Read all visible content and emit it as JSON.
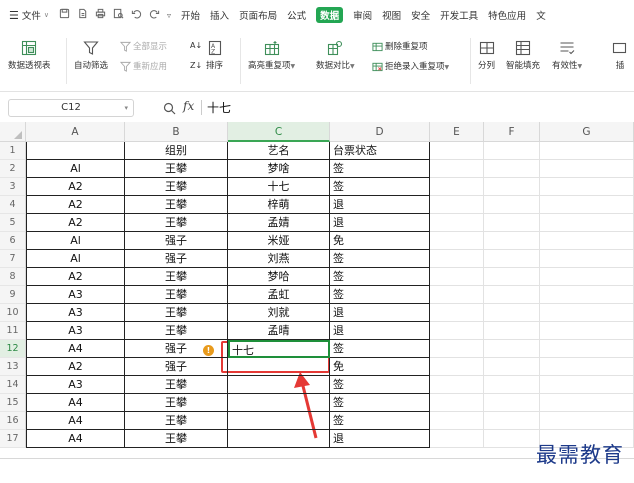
{
  "menu": {
    "file_label": "文件",
    "tabs": [
      "开始",
      "插入",
      "页面布局",
      "公式",
      "数据",
      "审阅",
      "视图",
      "安全",
      "开发工具",
      "特色应用",
      "文"
    ],
    "active_tab": "数据"
  },
  "ribbon": {
    "pivot": "数据透视表",
    "autofilter": "自动筛选",
    "show_all": "全部显示",
    "reapply": "重新应用",
    "sort": "排序",
    "highlight_dup": "高亮重复项",
    "compare": "数据对比",
    "remove_dup": "删除重复项",
    "reject_dup": "拒绝录入重复项",
    "split": "分列",
    "smart_fill": "智能填充",
    "validity": "有效性",
    "more": "插"
  },
  "formula_bar": {
    "cell_ref": "C12",
    "fx": "fx",
    "value": "十七"
  },
  "columns": [
    "A",
    "B",
    "C",
    "D",
    "E",
    "F",
    "G"
  ],
  "selected_column": "C",
  "selected_row": 12,
  "rows": [
    {
      "n": "1",
      "a": "",
      "b": "组别",
      "c": "艺名",
      "d": "台票状态"
    },
    {
      "n": "2",
      "a": "Al",
      "b": "王攀",
      "c": "梦啥",
      "d": "签"
    },
    {
      "n": "3",
      "a": "A2",
      "b": "王攀",
      "c": "十七",
      "d": "签"
    },
    {
      "n": "4",
      "a": "A2",
      "b": "王攀",
      "c": "梓萌",
      "d": "退"
    },
    {
      "n": "5",
      "a": "A2",
      "b": "王攀",
      "c": "孟婧",
      "d": "退"
    },
    {
      "n": "6",
      "a": "Al",
      "b": "强子",
      "c": "米娅",
      "d": "免"
    },
    {
      "n": "7",
      "a": "Al",
      "b": "强子",
      "c": "刘燕",
      "d": "签"
    },
    {
      "n": "8",
      "a": "A2",
      "b": "王攀",
      "c": "梦哈",
      "d": "签"
    },
    {
      "n": "9",
      "a": "A3",
      "b": "王攀",
      "c": "孟虹",
      "d": "签"
    },
    {
      "n": "10",
      "a": "A3",
      "b": "王攀",
      "c": "刘就",
      "d": "退"
    },
    {
      "n": "11",
      "a": "A3",
      "b": "王攀",
      "c": "孟晴",
      "d": "退"
    },
    {
      "n": "12",
      "a": "A4",
      "b": "强子",
      "c": "十七",
      "d": "签"
    },
    {
      "n": "13",
      "a": "A2",
      "b": "强子",
      "c": "",
      "d": "免"
    },
    {
      "n": "14",
      "a": "A3",
      "b": "王攀",
      "c": "",
      "d": "签"
    },
    {
      "n": "15",
      "a": "A4",
      "b": "王攀",
      "c": "",
      "d": "签"
    },
    {
      "n": "16",
      "a": "A4",
      "b": "王攀",
      "c": "",
      "d": "签"
    },
    {
      "n": "17",
      "a": "A4",
      "b": "王攀",
      "c": "",
      "d": "退"
    }
  ],
  "watermark": "最需教育",
  "colors": {
    "accent": "#23a653",
    "annotation": "#e53935",
    "watermark": "#1d3a8a"
  }
}
